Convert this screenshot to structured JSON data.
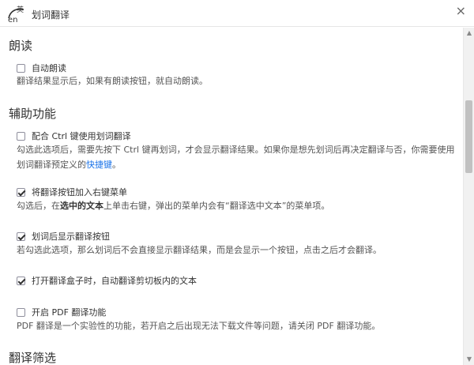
{
  "window": {
    "title": "划词翻译",
    "logo_text_top": "英",
    "logo_text_bottom": "en",
    "close_label": "×"
  },
  "sections": {
    "read": {
      "title": "朗读",
      "auto_read": {
        "label": "自动朗读",
        "checked": false,
        "desc": "翻译结果显示后，如果有朗读按钮，就自动朗读。"
      }
    },
    "assist": {
      "title": "辅助功能",
      "ctrl": {
        "label": "配合 Ctrl 键使用划词翻译",
        "checked": false,
        "desc_line1": "勾选此选项后，需要先按下 Ctrl 键再划词，才会显示翻译结果。如果你是想先划词后再决定翻译与否，你需要使用",
        "desc_line2_prefix": "划词翻译预定义的",
        "desc_line2_link": "快捷键",
        "desc_line2_suffix": "。"
      },
      "context_menu": {
        "label": "将翻译按钮加入右键菜单",
        "checked": true,
        "desc_prefix": "勾选后，在",
        "desc_bold": "选中的文本",
        "desc_suffix": "上单击右键，弹出的菜单内会有“翻译选中文本”的菜单项。"
      },
      "show_button": {
        "label": "划词后显示翻译按钮",
        "checked": true,
        "desc": "若勾选此选项，那么划词后不会直接显示翻译结果，而是会显示一个按钮，点击之后才会翻译。"
      },
      "clipboard": {
        "label": "打开翻译盒子时，自动翻译剪切板内的文本",
        "checked": true
      },
      "pdf": {
        "label": "开启 PDF 翻译功能",
        "checked": false,
        "desc": "PDF 翻译是一个实验性的功能，若开启之后出现无法下载文件等问题，请关闭 PDF 翻译功能。"
      }
    },
    "filter": {
      "title": "翻译筛选"
    }
  },
  "scrollbar": {
    "up_icon": "▲",
    "down_icon": "▼"
  }
}
